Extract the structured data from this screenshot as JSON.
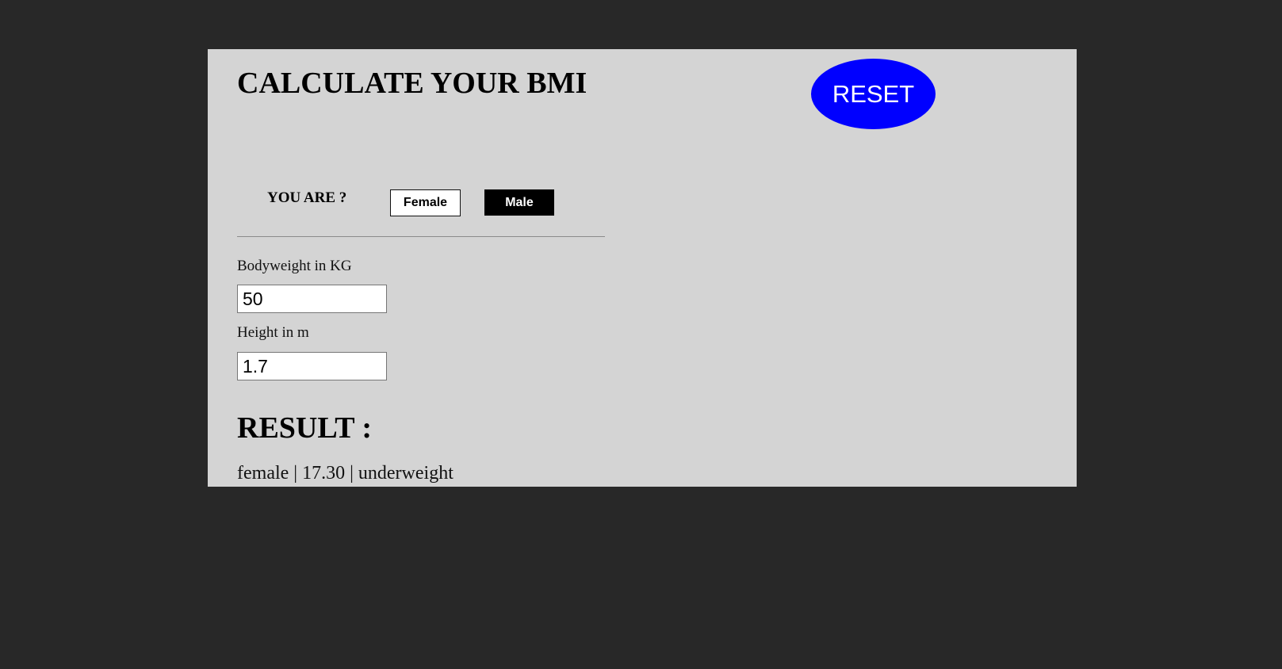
{
  "header": {
    "title": "CALCULATE YOUR BMI",
    "reset_label": "RESET"
  },
  "gender": {
    "label": "YOU ARE ?",
    "options": [
      {
        "label": "Female"
      },
      {
        "label": "Male"
      }
    ]
  },
  "form": {
    "weight_label": "Bodyweight in KG",
    "weight_value": "50",
    "height_label": "Height in m",
    "height_value": "1.7"
  },
  "result": {
    "heading": "RESULT :",
    "text": "female | 17.30 | underweight"
  },
  "colors": {
    "background": "#282828",
    "panel": "#d4d4d4",
    "reset_button": "#0000ff",
    "male_button": "#000000",
    "female_button": "#ffffff"
  }
}
